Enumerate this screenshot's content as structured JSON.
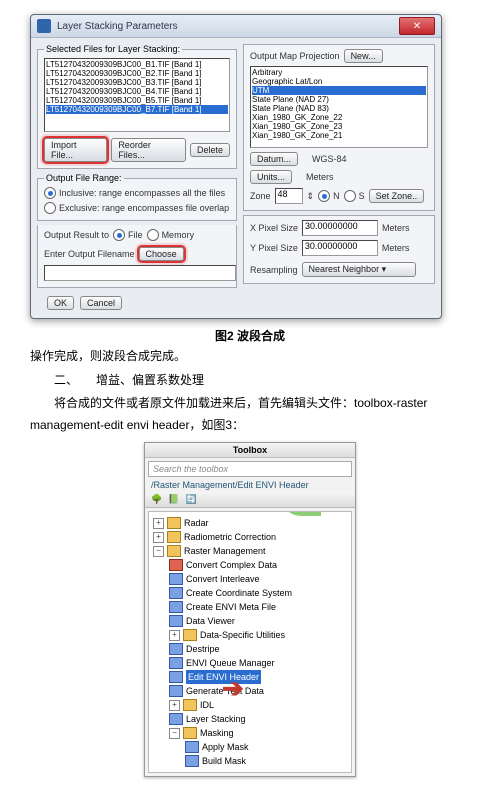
{
  "dialog": {
    "title": "Layer Stacking Parameters",
    "close": "✕",
    "selected_legend": "Selected Files for Layer Stacking:",
    "files": [
      "LT51270432009309BJC00_B1.TIF [Band 1]",
      "LT51270432009309BJC00_B2.TIF [Band 1]",
      "LT51270432009309BJC00_B3.TIF [Band 1]",
      "LT51270432009309BJC00_B4.TIF [Band 1]",
      "LT51270432009309BJC00_B5.TIF [Band 1]",
      "LT51270432009309BJC00_B7.TIF [Band 1]"
    ],
    "btn_import": "Import File...",
    "btn_reorder": "Reorder Files...",
    "btn_delete": "Delete",
    "range_legend": "Output File Range:",
    "range_inclusive": "Inclusive: range encompasses all the files",
    "range_exclusive": "Exclusive: range encompasses file overlap",
    "result_label": "Output Result to",
    "result_file": "File",
    "result_memory": "Memory",
    "out_filename_label": "Enter Output Filename",
    "btn_choose": "Choose",
    "btn_ok": "OK",
    "btn_cancel": "Cancel",
    "proj_label": "Output Map Projection",
    "btn_new": "New...",
    "projections": [
      "Arbitrary",
      "Geographic Lat/Lon",
      "UTM",
      "State Plane (NAD 27)",
      "State Plane (NAD 83)",
      "Xian_1980_GK_Zone_22",
      "Xian_1980_GK_Zone_23",
      "Xian_1980_GK_Zone_21"
    ],
    "btn_datum": "Datum...",
    "datum_val": "WGS-84",
    "btn_units": "Units...",
    "units_val": "Meters",
    "zone_label": "Zone",
    "zone_val": "48",
    "zone_n": "N",
    "zone_s": "S",
    "btn_setzone": "Set Zone..",
    "xsize_label": "X Pixel Size",
    "xsize_val": "30.00000000",
    "ysize_label": "Y Pixel Size",
    "ysize_val": "30.00000000",
    "meters": "Meters",
    "resamp_label": "Resampling",
    "resamp_val": "Nearest Neighbor ▾"
  },
  "doc": {
    "fig2": "图2 波段合成",
    "p1": "操作完成，则波段合成完成。",
    "p2_head": "二、　　增益、偏置系数处理",
    "p3": "将合成的文件或者原文件加载进来后，首先编辑头文件：toolbox-raster management-edit envi header，如图3：",
    "toolbox_title": "Toolbox",
    "search_ph": "Search the toolbox",
    "path": "/Raster Management/Edit ENVI Header",
    "nodes": {
      "radar": "Radar",
      "radio": "Radiometric Correction",
      "raster": "Raster Management",
      "conv_complex": "Convert Complex Data",
      "conv_inter": "Convert Interleave",
      "create_coord": "Create Coordinate System",
      "create_meta": "Create ENVI Meta File",
      "data_viewer": "Data Viewer",
      "data_spec": "Data-Specific Utilities",
      "destripe": "Destripe",
      "queue": "ENVI Queue Manager",
      "edit_header": "Edit ENVI Header",
      "gen_test": "Generate Test Data",
      "idl": "IDL",
      "layer_stack": "Layer Stacking",
      "masking": "Masking",
      "apply_mask": "Apply Mask",
      "build_mask": "Build Mask"
    }
  }
}
